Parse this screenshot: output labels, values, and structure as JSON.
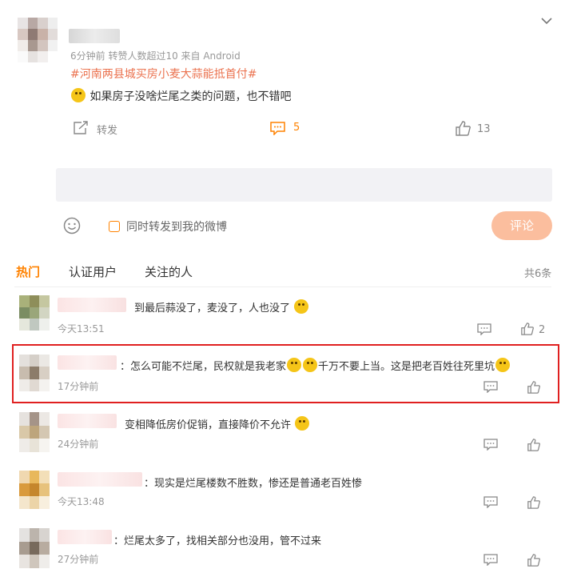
{
  "post": {
    "meta": "6分钟前 转赞人数超过10 来自 Android",
    "topic": "#河南两县城买房小麦大蒜能抵首付#",
    "text": "如果房子没啥烂尾之类的问题，也不错吧",
    "forward_label": "转发",
    "comment_count": "5",
    "like_count": "13"
  },
  "composer": {
    "checkbox_label": "同时转发到我的微博",
    "submit_label": "评论"
  },
  "tabs": {
    "hot": "热门",
    "verified": "认证用户",
    "following": "关注的人",
    "total": "共6条"
  },
  "comments": [
    {
      "text": "到最后蒜没了，麦没了，人也没了",
      "time": "今天13:51",
      "likes": "2"
    },
    {
      "text": "：怎么可能不烂尾，民权就是我老家",
      "text2": "千万不要上当。这是把老百姓往死里坑",
      "time": "17分钟前",
      "likes": ""
    },
    {
      "text": "变相降低房价促销，直接降价不允许",
      "time": "24分钟前",
      "likes": ""
    },
    {
      "text": "：现实是烂尾楼数不胜数，惨还是普通老百姓惨",
      "time": "今天13:48",
      "likes": ""
    },
    {
      "text": "：烂尾太多了，找相关部分也没用，管不过来",
      "time": "27分钟前",
      "likes": ""
    }
  ],
  "colors": {
    "accent": "#ff8200",
    "topic": "#eb7350",
    "highlight_border": "#e02020",
    "submit_bg": "#fbbe9e"
  }
}
